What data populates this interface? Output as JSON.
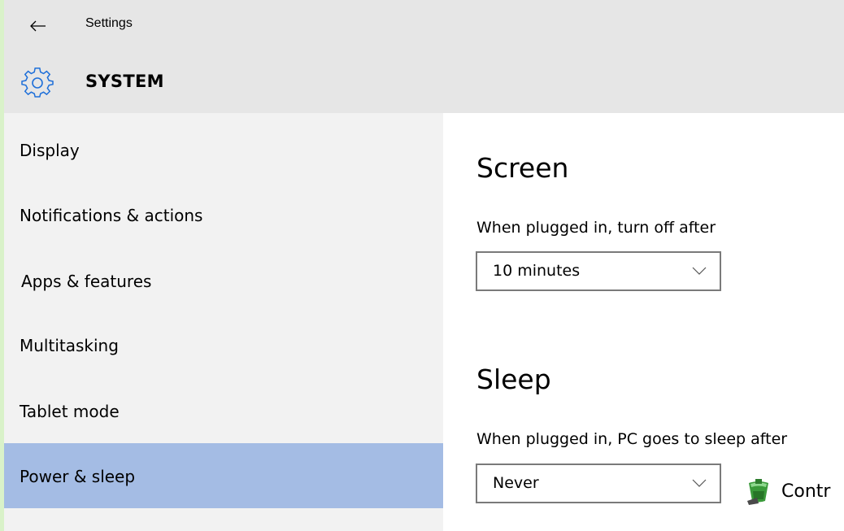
{
  "window": {
    "back_icon": "back-arrow-icon",
    "title": "Settings"
  },
  "header": {
    "icon": "gear-icon",
    "section": "SYSTEM"
  },
  "sidebar": {
    "items": [
      {
        "label": "Display",
        "selected": false
      },
      {
        "label": "Notifications & actions",
        "selected": false
      },
      {
        "label": "Apps & features",
        "selected": false
      },
      {
        "label": "Multitasking",
        "selected": false
      },
      {
        "label": "Tablet mode",
        "selected": false
      },
      {
        "label": "Power & sleep",
        "selected": true
      }
    ]
  },
  "screen": {
    "heading": "Screen",
    "plugged_in_label": "When plugged in, turn off after",
    "plugged_in_value": "10 minutes"
  },
  "sleep": {
    "heading": "Sleep",
    "plugged_in_label": "When plugged in, PC goes to sleep after",
    "plugged_in_value": "Never"
  },
  "control_panel": {
    "icon": "control-panel-icon",
    "label": "Contr"
  },
  "colors": {
    "header_bg": "#e6e6e6",
    "sidebar_bg": "#f2f2f2",
    "selected_bg": "#a4bce4",
    "accent": "#1e6fd9",
    "dropdown_border": "#7a7a7a"
  }
}
